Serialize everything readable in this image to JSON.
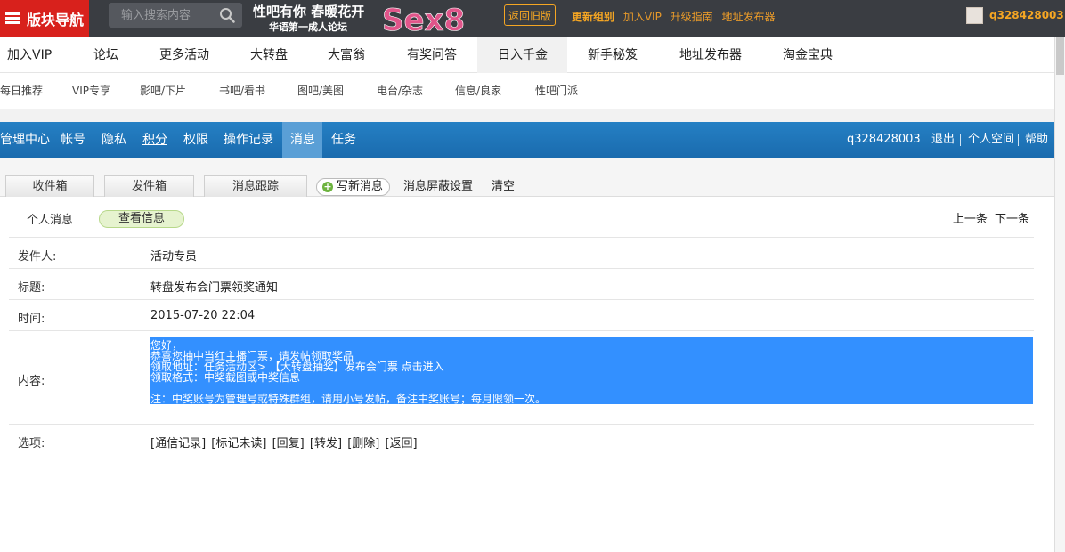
{
  "topbar": {
    "brand": "版块导航",
    "search_placeholder": "输入搜索内容",
    "slogan_main": "性吧有你 春暖花开",
    "slogan_sub": "华语第一成人论坛",
    "logo_text": "Sex8",
    "old_version": "返回旧版",
    "links": [
      "更新组别",
      "加入VIP",
      "升级指南",
      "地址发布器"
    ],
    "username": "q328428003",
    "accent": "#f5a623",
    "brand_color": "#d8211c"
  },
  "mainnav": [
    "加入VIP",
    "论坛",
    "更多活动",
    "大转盘",
    "大富翁",
    "有奖问答",
    "日入千金",
    "新手秘笈",
    "地址发布器",
    "淘金宝典"
  ],
  "subnav": [
    "每日推荐",
    "VIP专享",
    "影吧/下片",
    "书吧/看书",
    "图吧/美图",
    "电台/杂志",
    "信息/良家",
    "性吧门派"
  ],
  "usernav": {
    "items": [
      "管理中心",
      "帐号",
      "隐私",
      "积分",
      "权限",
      "操作记录",
      "消息",
      "任务"
    ],
    "active": "消息",
    "username": "q328428003",
    "logout": "退出",
    "space": "个人空间",
    "help": "帮助"
  },
  "tabs": {
    "items": [
      "收件箱",
      "发件箱",
      "消息跟踪"
    ],
    "compose": "写新消息",
    "block_settings": "消息屏蔽设置",
    "clear": "清空"
  },
  "subtabs": {
    "personal": "个人消息",
    "view": "查看信息",
    "prev": "上一条",
    "next": "下一条"
  },
  "message": {
    "sender_label": "发件人:",
    "sender": "活动专员",
    "title_label": "标题:",
    "title": "转盘发布会门票领奖通知",
    "time_label": "时间:",
    "time": "2015-07-20 22:04",
    "content_label": "内容:",
    "content_lines": [
      "您好，",
      "恭喜您抽中当红主播门票，请发帖领取奖品",
      "领取地址：任务活动区> 【大转盘抽奖】发布会门票 点击进入",
      "领取格式：中奖截图或中奖信息",
      "",
      "注：中奖账号为管理号或特殊群组，请用小号发帖，备注中奖账号；每月限领一次。"
    ],
    "options_label": "选项:",
    "options": [
      "[通信记录]",
      "[标记未读]",
      "[回复]",
      "[转发]",
      "[删除]",
      "[返回]"
    ]
  }
}
